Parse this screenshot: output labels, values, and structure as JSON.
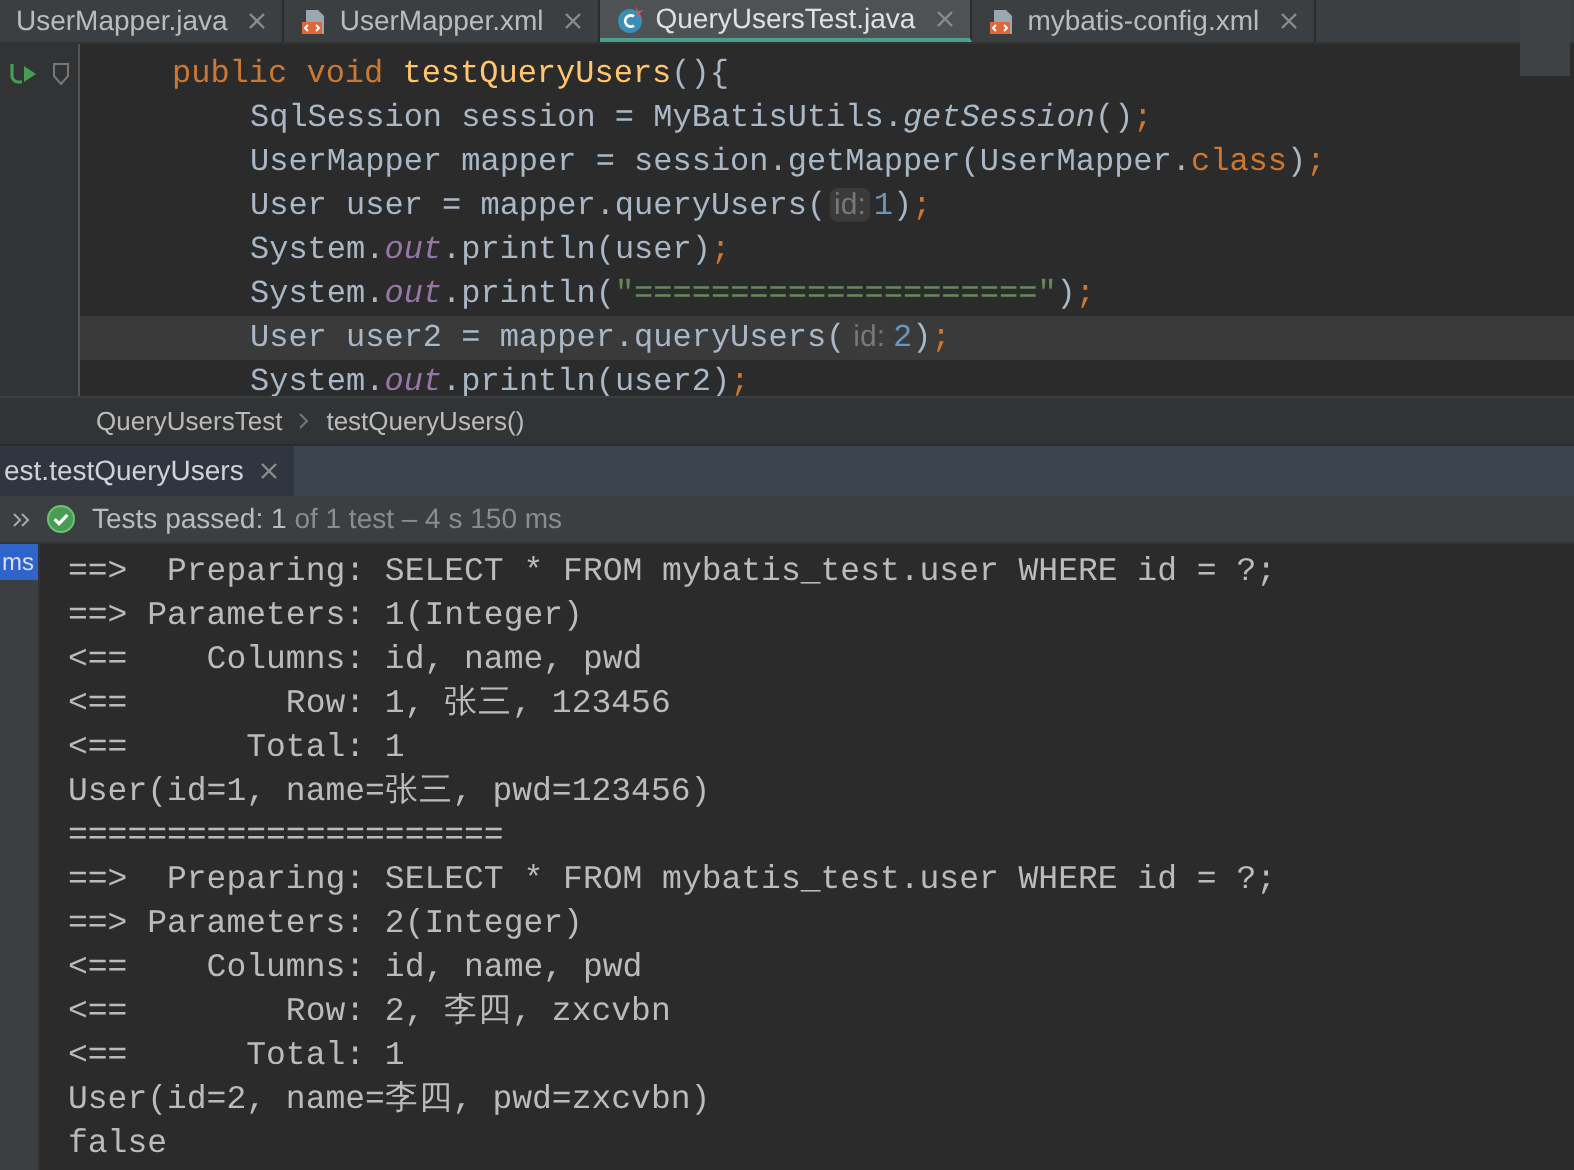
{
  "editor_tabs": [
    {
      "label": "UserMapper.java",
      "kind": "plain",
      "selected": false
    },
    {
      "label": "UserMapper.xml",
      "kind": "xml",
      "selected": false
    },
    {
      "label": "QueryUsersTest.java",
      "kind": "test",
      "selected": true
    },
    {
      "label": "mybatis-config.xml",
      "kind": "xml",
      "selected": false
    }
  ],
  "code_lines": [
    {
      "current": false,
      "tokens": [
        {
          "kind": "kw",
          "text": "public void "
        },
        {
          "kind": "decl",
          "text": "testQueryUsers"
        },
        {
          "kind": "plain",
          "text": "(){"
        }
      ],
      "children": [
        {
          "current": false,
          "tokens": [
            {
              "kind": "plain",
              "text": "SqlSession session = MyBatisUtils."
            },
            {
              "kind": "static",
              "text": "getSession"
            },
            {
              "kind": "plain",
              "text": "()"
            },
            {
              "kind": "kw",
              "text": ";"
            }
          ]
        },
        {
          "current": false,
          "tokens": [
            {
              "kind": "plain",
              "text": "UserMapper mapper = session.getMapper(UserMapper."
            },
            {
              "kind": "kw",
              "text": "class"
            },
            {
              "kind": "plain",
              "text": ")"
            },
            {
              "kind": "kw",
              "text": ";"
            }
          ]
        },
        {
          "current": false,
          "tokens": [
            {
              "kind": "plain",
              "text": "User user = mapper.queryUsers("
            },
            {
              "kind": "hint",
              "text": "id:"
            },
            {
              "kind": "num",
              "text": "1"
            },
            {
              "kind": "plain",
              "text": ")"
            },
            {
              "kind": "kw",
              "text": ";"
            }
          ]
        },
        {
          "current": false,
          "tokens": [
            {
              "kind": "plain",
              "text": "System."
            },
            {
              "kind": "field",
              "text": "out"
            },
            {
              "kind": "plain",
              "text": ".println(user)"
            },
            {
              "kind": "kw",
              "text": ";"
            }
          ]
        },
        {
          "current": false,
          "tokens": [
            {
              "kind": "plain",
              "text": "System."
            },
            {
              "kind": "field",
              "text": "out"
            },
            {
              "kind": "plain",
              "text": ".println("
            },
            {
              "kind": "str",
              "text": "\"=====================\""
            },
            {
              "kind": "plain",
              "text": ")"
            },
            {
              "kind": "kw",
              "text": ";"
            }
          ]
        },
        {
          "current": true,
          "tokens": [
            {
              "kind": "plain",
              "text": "User user2 = mapper.queryUsers("
            },
            {
              "kind": "hint",
              "text": "id:"
            },
            {
              "kind": "num",
              "text": "2"
            },
            {
              "kind": "plain",
              "text": ")"
            },
            {
              "kind": "kw",
              "text": ";"
            }
          ]
        },
        {
          "current": false,
          "tokens": [
            {
              "kind": "plain",
              "text": "System."
            },
            {
              "kind": "field",
              "text": "out"
            },
            {
              "kind": "plain",
              "text": ".println(user2)"
            },
            {
              "kind": "kw",
              "text": ";"
            }
          ]
        }
      ]
    }
  ],
  "breadcrumbs": [
    "QueryUsersTest",
    "testQueryUsers()"
  ],
  "run_tab": {
    "label": "est.testQueryUsers",
    "selected": true
  },
  "test_status": {
    "label": "Tests passed:",
    "count": "1",
    "detail": "of 1 test – 4 s 150 ms"
  },
  "tree_badge": "ms",
  "console_lines": [
    "==>  Preparing: SELECT * FROM mybatis_test.user WHERE id = ?;",
    "==> Parameters: 1(Integer)",
    "<==    Columns: id, name, pwd",
    "<==        Row: 1, 张三, 123456",
    "<==      Total: 1",
    "User(id=1, name=张三, pwd=123456)",
    "======================",
    "==>  Preparing: SELECT * FROM mybatis_test.user WHERE id = ?;",
    "==> Parameters: 2(Integer)",
    "<==    Columns: id, name, pwd",
    "<==        Row: 2, 李四, zxcvbn",
    "<==      Total: 1",
    "User(id=2, name=李四, pwd=zxcvbn)",
    "false"
  ]
}
